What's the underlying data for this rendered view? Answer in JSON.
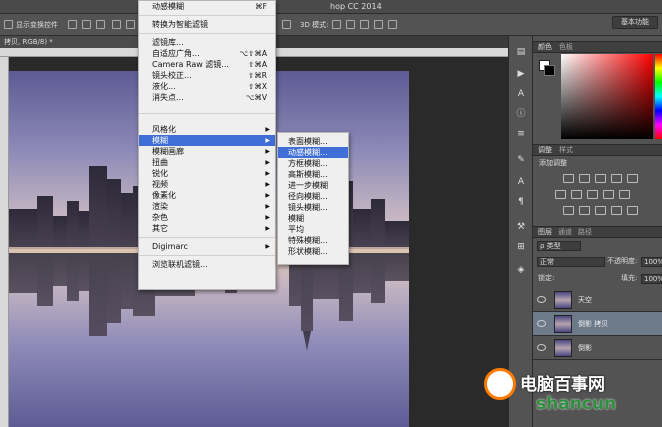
{
  "app": {
    "title_partial": "hop CC 2014",
    "mode_3d": "3D 模式:",
    "workspace": "基本功能"
  },
  "options_bar": {
    "show_transform_label": "显示变换控件"
  },
  "document": {
    "tab_label": "拷贝, RGB/8) *"
  },
  "filter_menu": {
    "last_filter": {
      "label": "动感模糊",
      "shortcut": "⌘F"
    },
    "convert_smart": "转换为智能滤镜",
    "group1": [
      {
        "label": "滤镜库...",
        "shortcut": ""
      },
      {
        "label": "自适应广角...",
        "shortcut": "⌥⇧⌘A"
      },
      {
        "label": "Camera Raw 滤镜...",
        "shortcut": "⇧⌘A"
      },
      {
        "label": "镜头校正...",
        "shortcut": "⇧⌘R"
      },
      {
        "label": "液化...",
        "shortcut": "⇧⌘X"
      },
      {
        "label": "消失点...",
        "shortcut": "⌥⌘V"
      }
    ],
    "group2": [
      {
        "label": "风格化"
      },
      {
        "label": "模糊",
        "highlighted": true
      },
      {
        "label": "模糊画廊"
      },
      {
        "label": "扭曲"
      },
      {
        "label": "锐化"
      },
      {
        "label": "视频"
      },
      {
        "label": "像素化"
      },
      {
        "label": "渲染"
      },
      {
        "label": "杂色"
      },
      {
        "label": "其它"
      }
    ],
    "digimarc": "Digimarc",
    "browse_online": "浏览联机滤镜..."
  },
  "blur_submenu": {
    "items": [
      {
        "label": "表面模糊..."
      },
      {
        "label": "动感模糊...",
        "highlighted": true
      },
      {
        "label": "方框模糊..."
      },
      {
        "label": "高斯模糊..."
      },
      {
        "label": "进一步模糊"
      },
      {
        "label": "径向模糊..."
      },
      {
        "label": "镜头模糊..."
      },
      {
        "label": "模糊"
      },
      {
        "label": "平均"
      },
      {
        "label": "特殊模糊..."
      },
      {
        "label": "形状模糊..."
      }
    ]
  },
  "panels": {
    "color_tabs": [
      "颜色",
      "色板"
    ],
    "adjust_tabs": [
      "调整",
      "样式"
    ],
    "adjust_title": "添加调整",
    "layers_tabs": [
      "图层",
      "通道",
      "路径"
    ],
    "filter_kind": "ρ 类型",
    "blend_mode": "正常",
    "opacity_label": "不透明度:",
    "opacity_value": "100%",
    "lock_label": "锁定:",
    "fill_label": "填充:",
    "fill_value": "100%",
    "layers": [
      {
        "name": "天空",
        "selected": false
      },
      {
        "name": "倒影 拷贝",
        "selected": true
      },
      {
        "name": "倒影",
        "selected": false
      }
    ]
  },
  "watermark": {
    "title": "电脑百事网",
    "sub": "shancun"
  },
  "colors": {
    "menu_highlight": "#3f6fd6",
    "panel_bg": "#535353",
    "selected_layer": "#6d7a8a"
  }
}
